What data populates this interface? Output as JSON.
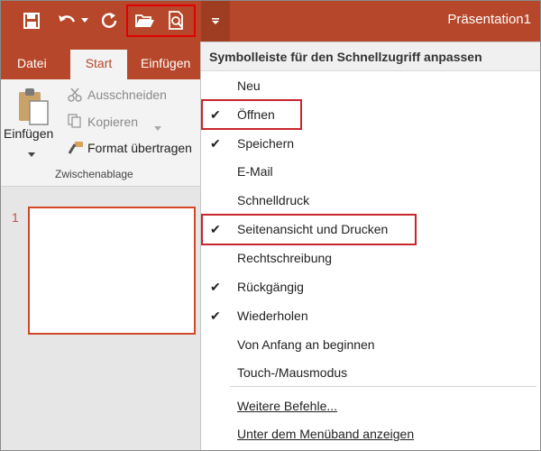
{
  "app": {
    "title": "Präsentation1"
  },
  "qat": {
    "icons": [
      "save-icon",
      "undo-icon",
      "undo-dropdown-icon",
      "redo-icon",
      "open-folder-icon",
      "print-preview-icon",
      "customize-arrow-icon"
    ]
  },
  "tabs": [
    {
      "label": "Datei"
    },
    {
      "label": "Start"
    },
    {
      "label": "Einfügen"
    }
  ],
  "ribbon": {
    "paste_label": "Einfügen",
    "cut_label": "Ausschneiden",
    "copy_label": "Kopieren",
    "format_painter_label": "Format übertragen",
    "group_label": "Zwischenablage"
  },
  "slides": {
    "first_number": "1"
  },
  "menu": {
    "header": "Symbolleiste für den Schnellzugriff anpassen",
    "items": [
      {
        "label": "Neu",
        "checked": false
      },
      {
        "label": "Öffnen",
        "checked": true
      },
      {
        "label": "Speichern",
        "checked": true
      },
      {
        "label": "E-Mail",
        "checked": false
      },
      {
        "label": "Schnelldruck",
        "checked": false
      },
      {
        "label": "Seitenansicht und Drucken",
        "checked": true
      },
      {
        "label": "Rechtschreibung",
        "checked": false
      },
      {
        "label": "Rückgängig",
        "checked": true
      },
      {
        "label": "Wiederholen",
        "checked": true
      },
      {
        "label": "Von Anfang an beginnen",
        "checked": false
      },
      {
        "label": "Touch-/Mausmodus",
        "checked": false
      }
    ],
    "more_commands": "Weitere Befehle...",
    "show_below": "Unter dem Menüband anzeigen",
    "check_glyph": "✔"
  },
  "colors": {
    "accent": "#b7472a",
    "highlight": "#c8252c"
  }
}
